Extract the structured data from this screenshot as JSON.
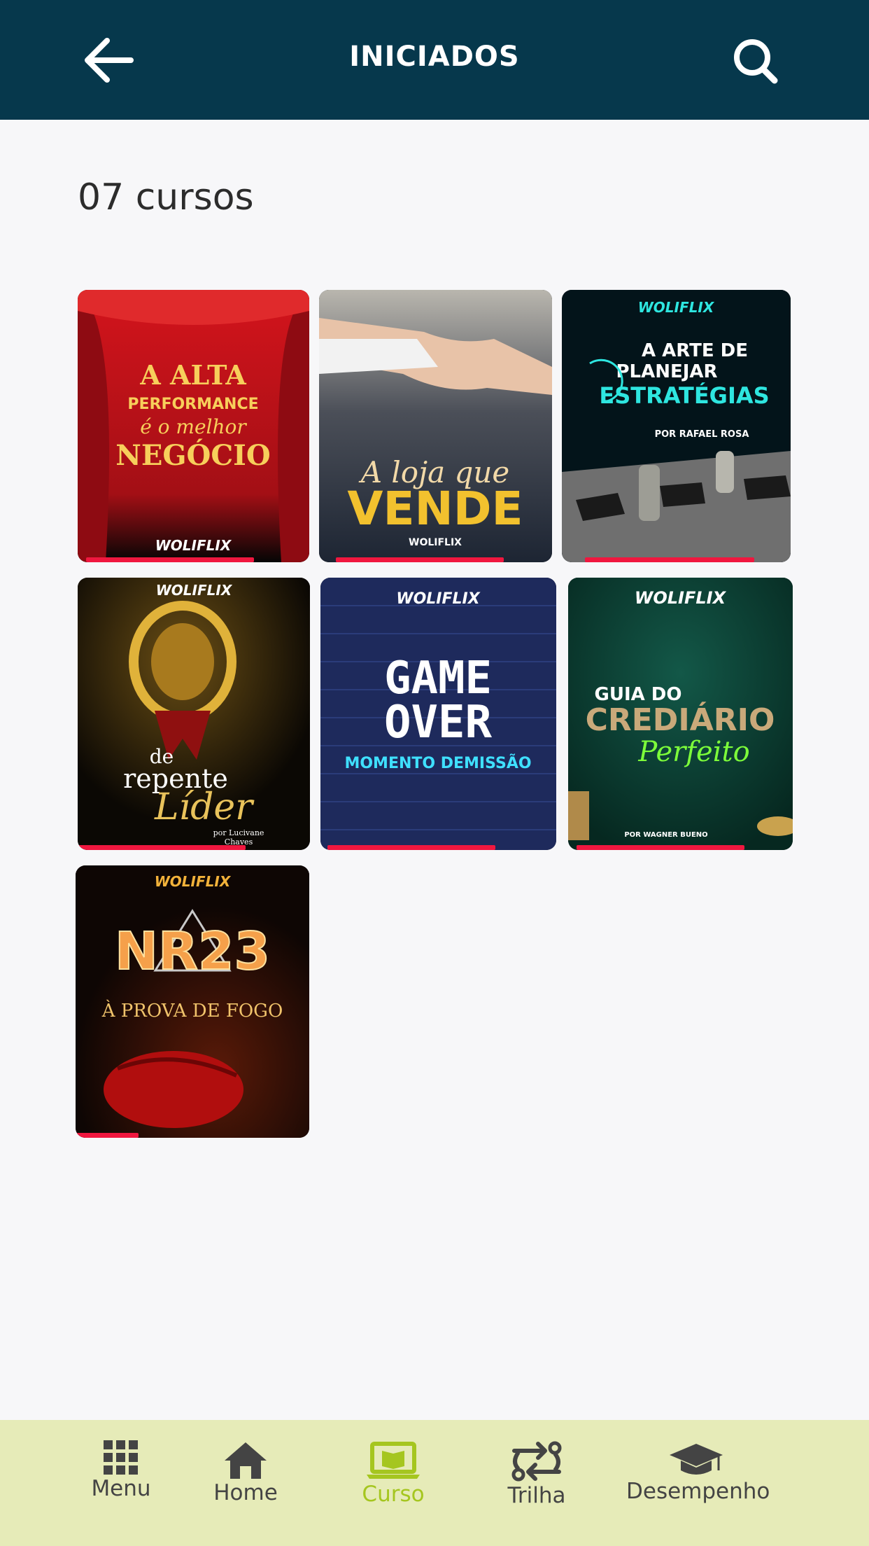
{
  "header": {
    "title": "INICIADOS",
    "back_icon": "arrow-left-icon",
    "search_icon": "search-icon"
  },
  "count_label": "07 cursos",
  "courses": [
    {
      "title_lines": [
        "A ALTA",
        "PERFORMANCE",
        "é o melhor",
        "NEGÓCIO"
      ],
      "brand": "WOLIFLIX",
      "progress": 0.75,
      "theme": "#b0141a"
    },
    {
      "title_lines": [
        "A loja que",
        "VENDE"
      ],
      "brand": "WOLIFLIX",
      "progress": 0.72,
      "theme": "#2a3342"
    },
    {
      "title_lines": [
        "A ARTE DE",
        "PLANEJAR",
        "ESTRATÉGIAS",
        "POR RAFAEL ROSA"
      ],
      "brand": "WOLIFLIX",
      "progress": 0.74,
      "theme": "#061a1d"
    },
    {
      "title_lines": [
        "de",
        "repente",
        "Líder",
        "por Lucivane",
        "Chaves"
      ],
      "brand": "WOLIFLIX",
      "progress": 0.72,
      "theme": "#1b1406"
    },
    {
      "title_lines": [
        "GAME",
        "OVER",
        "MOMENTO DEMISSÃO"
      ],
      "brand": "WOLIFLIX",
      "progress": 0.72,
      "theme": "#1e2a5a"
    },
    {
      "title_lines": [
        "GUIA DO",
        "CREDIÁRIO",
        "Perfeito",
        "POR WAGNER BUENO"
      ],
      "brand": "WOLIFLIX",
      "progress": 0.75,
      "theme": "#0e3f36"
    },
    {
      "title_lines": [
        "NR23",
        "À PROVA DE FOGO"
      ],
      "brand": "WOLIFLIX",
      "progress": 0.27,
      "theme": "#140604"
    }
  ],
  "nav": {
    "items": [
      {
        "label": "Menu",
        "icon": "grid-icon"
      },
      {
        "label": "Home",
        "icon": "home-icon"
      },
      {
        "label": "Curso",
        "icon": "laptop-book-icon",
        "active": true
      },
      {
        "label": "Trilha",
        "icon": "route-icon"
      },
      {
        "label": "Desempenho",
        "icon": "graduation-cap-icon"
      }
    ],
    "active_color": "#a5c61f"
  },
  "colors": {
    "header_bg": "#06384c",
    "progress": "#f0173f",
    "nav_bg": "#e6ebb8"
  }
}
